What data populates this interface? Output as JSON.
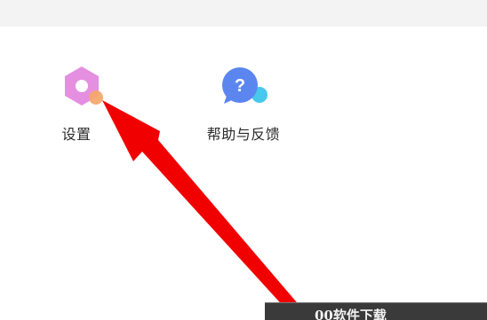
{
  "menu": {
    "settings_label": "设置",
    "help_label": "帮助与反馈",
    "help_icon_glyph": "?"
  },
  "watermark": {
    "text": "00软件下载"
  },
  "icons": {
    "settings": "gear-icon",
    "help": "help-bubble-icon"
  },
  "colors": {
    "settings_icon": "#e58fe0",
    "settings_badge": "#f4a86a",
    "help_icon": "#5b86ef",
    "help_badge": "#47c8ec",
    "annotation_arrow": "#f10000",
    "watermark_bg": "#3a3a3a"
  }
}
